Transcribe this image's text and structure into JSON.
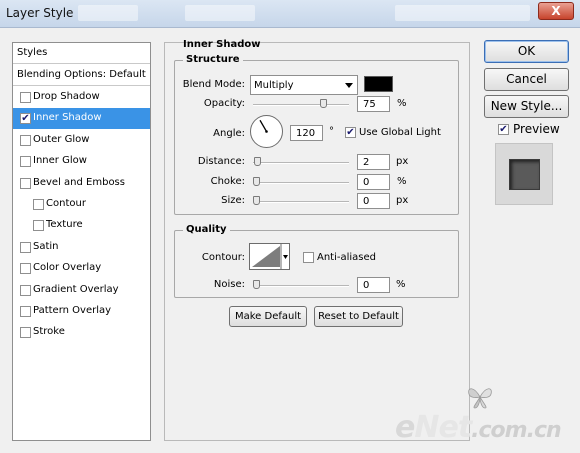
{
  "window": {
    "title": "Layer Style",
    "close_glyph": "X"
  },
  "left_panel": {
    "header": "Styles",
    "blending": "Blending Options: Default",
    "items": [
      {
        "label": "Drop Shadow",
        "checked": false,
        "selected": false,
        "indent": false
      },
      {
        "label": "Inner Shadow",
        "checked": true,
        "selected": true,
        "indent": false
      },
      {
        "label": "Outer Glow",
        "checked": false,
        "selected": false,
        "indent": false
      },
      {
        "label": "Inner Glow",
        "checked": false,
        "selected": false,
        "indent": false
      },
      {
        "label": "Bevel and Emboss",
        "checked": false,
        "selected": false,
        "indent": false
      },
      {
        "label": "Contour",
        "checked": false,
        "selected": false,
        "indent": true
      },
      {
        "label": "Texture",
        "checked": false,
        "selected": false,
        "indent": true
      },
      {
        "label": "Satin",
        "checked": false,
        "selected": false,
        "indent": false
      },
      {
        "label": "Color Overlay",
        "checked": false,
        "selected": false,
        "indent": false
      },
      {
        "label": "Gradient Overlay",
        "checked": false,
        "selected": false,
        "indent": false
      },
      {
        "label": "Pattern Overlay",
        "checked": false,
        "selected": false,
        "indent": false
      },
      {
        "label": "Stroke",
        "checked": false,
        "selected": false,
        "indent": false
      }
    ]
  },
  "main": {
    "section_title": "Inner Shadow",
    "structure": {
      "legend": "Structure",
      "blend_mode_label": "Blend Mode:",
      "blend_mode_value": "Multiply",
      "shadow_color": "#000000",
      "opacity_label": "Opacity:",
      "opacity_value": "75",
      "opacity_unit": "%",
      "opacity_fraction": 0.75,
      "angle_label": "Angle:",
      "angle_value": "120",
      "angle_unit": "°",
      "use_global_light_label": "Use Global Light",
      "use_global_light": true,
      "distance_label": "Distance:",
      "distance_value": "2",
      "distance_unit": "px",
      "distance_fraction": 0.008,
      "choke_label": "Choke:",
      "choke_value": "0",
      "choke_unit": "%",
      "choke_fraction": 0,
      "size_label": "Size:",
      "size_value": "0",
      "size_unit": "px",
      "size_fraction": 0
    },
    "quality": {
      "legend": "Quality",
      "contour_label": "Contour:",
      "anti_aliased_label": "Anti-aliased",
      "anti_aliased": false,
      "noise_label": "Noise:",
      "noise_value": "0",
      "noise_unit": "%",
      "noise_fraction": 0
    },
    "make_default": "Make Default",
    "reset_default": "Reset to Default"
  },
  "buttons": {
    "ok": "OK",
    "cancel": "Cancel",
    "new_style": "New Style..."
  },
  "preview": {
    "label": "Preview",
    "checked": true
  },
  "watermark": {
    "part1": "e",
    "part2": "Net",
    "part3": ".com.cn"
  },
  "icons": [
    "close-icon",
    "chevron-down-icon",
    "angle-dial-icon",
    "contour-curve-icon",
    "checkmark-icon",
    "butterfly-icon"
  ]
}
